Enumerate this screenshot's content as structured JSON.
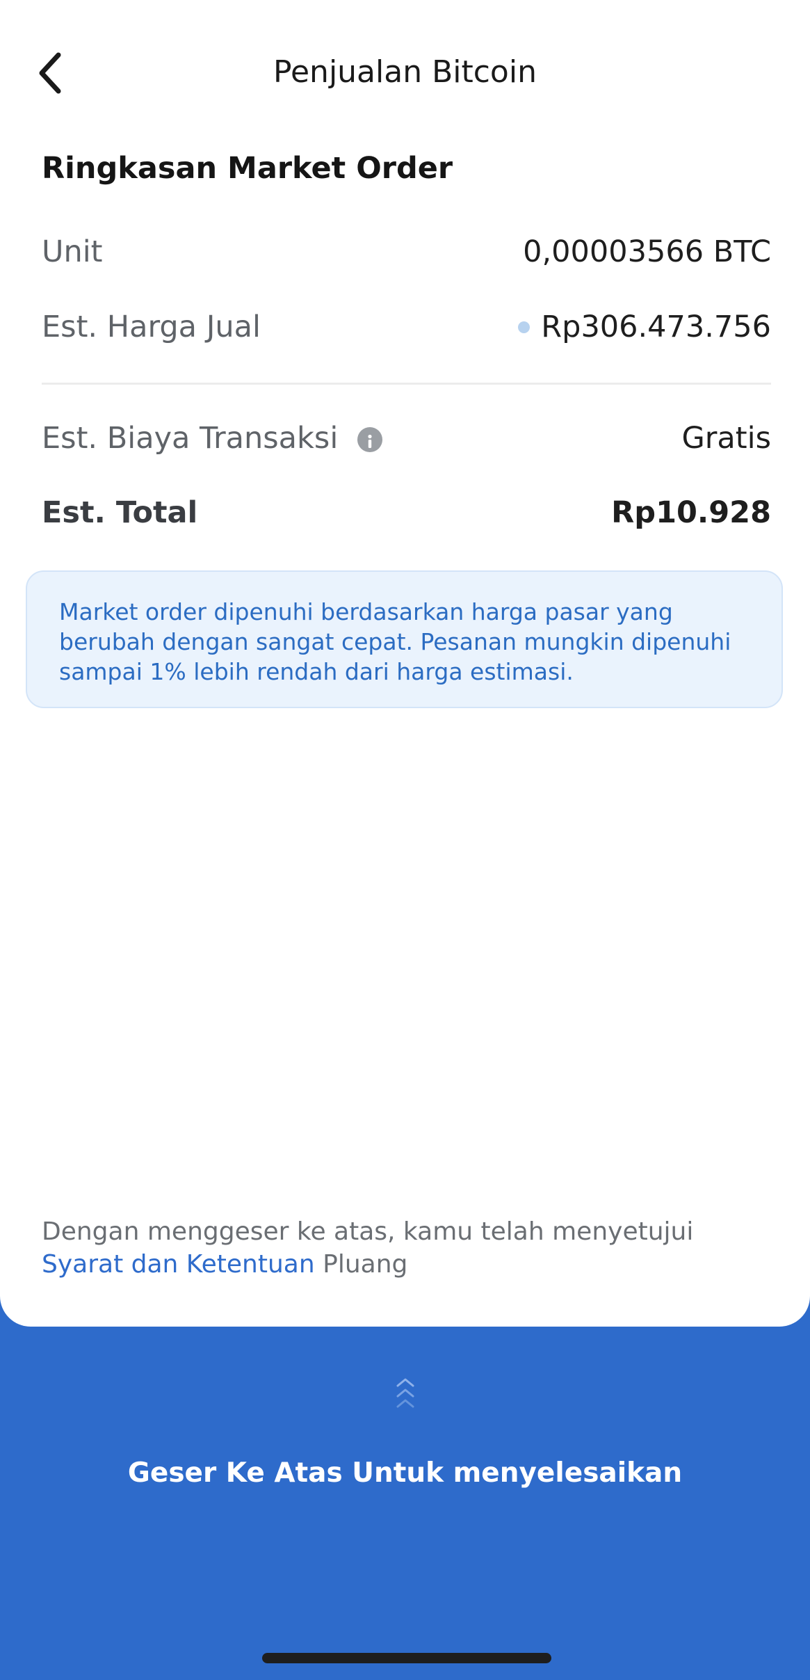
{
  "header": {
    "title": "Penjualan Bitcoin",
    "back_icon": "chevron-left-icon"
  },
  "summary": {
    "title": "Ringkasan Market Order",
    "unit_label": "Unit",
    "unit_value": "0,00003566 BTC",
    "price_label": "Est. Harga Jual",
    "price_value": "Rp306.473.756",
    "fee_label": "Est. Biaya Transaksi",
    "fee_value": "Gratis",
    "total_label": "Est. Total",
    "total_value": "Rp10.928"
  },
  "notice": {
    "text": "Market order dipenuhi berdasarkan harga pasar yang berubah dengan sangat cepat. Pesanan mungkin dipenuhi sampai 1% lebih rendah dari harga estimasi."
  },
  "consent": {
    "prefix": "Dengan menggeser ke atas, kamu telah menyetujui ",
    "link": "Syarat dan Ketentuan",
    "suffix": " Pluang"
  },
  "swipe": {
    "label": "Geser Ke Atas Untuk menyelesaikan",
    "icon": "chevrons-up-icon"
  },
  "colors": {
    "brand_blue": "#2e6bcb",
    "notice_bg": "#eaf3fd",
    "notice_text": "#2b6cc2",
    "price_dot": "#b7d2ef"
  }
}
